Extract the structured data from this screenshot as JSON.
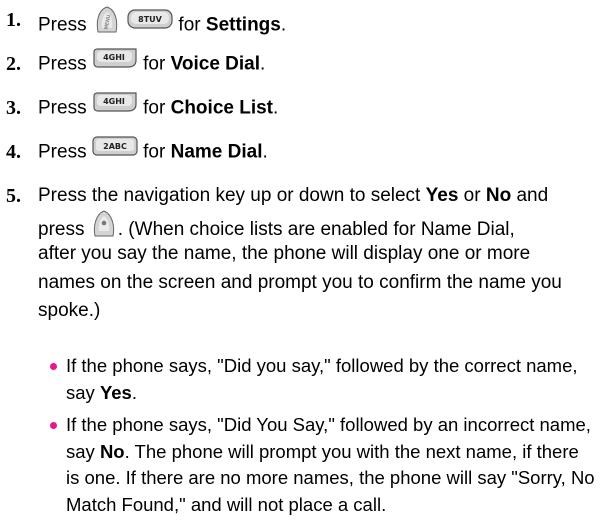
{
  "steps": [
    {
      "num": "1.",
      "pre": "Press",
      "mid": "for",
      "bold": "Settings",
      "post": ".",
      "keys": [
        "menu-key-icon",
        "8tuv-key-icon"
      ],
      "key_label_8": "8TUV"
    },
    {
      "num": "2.",
      "pre": "Press",
      "mid": "for",
      "bold": "Voice Dial",
      "post": ".",
      "keys": [
        "4ghi-key-icon"
      ],
      "key_label": "4GHI"
    },
    {
      "num": "3.",
      "pre": "Press",
      "mid": "for",
      "bold": "Choice List",
      "post": ".",
      "keys": [
        "4ghi-key-icon"
      ],
      "key_label": "4GHI"
    },
    {
      "num": "4.",
      "pre": "Press",
      "mid": "for",
      "bold": "Name Dial",
      "post": ".",
      "keys": [
        "2abc-key-icon"
      ],
      "key_label": "2ABC"
    }
  ],
  "step5": {
    "num": "5.",
    "line1_pre": "Press the navigation key up or down to select",
    "yes": "Yes",
    "or": "or",
    "no": "No",
    "and": "and",
    "line2_pre": "press",
    "line2_post": ". (When choice lists are enabled for Name Dial,",
    "rest": "after you say the name, the phone will display one or more names on the screen and prompt you to confirm the name you spoke.)"
  },
  "bullets": [
    {
      "pre": "If the phone says, \"Did you say,\" followed by the correct name, say",
      "bold": "Yes",
      "post": "."
    },
    {
      "pre": "If the phone says, \"Did You Say,\" followed by an incorrect name, say",
      "bold": "No",
      "post": ". The phone will prompt you with the next name, if there is one. If there are no more names, the phone will say \"Sorry, No Match Found,\" and will not place a call."
    }
  ],
  "colors": {
    "bullet": "#e9178a",
    "key_face": "#c9c9c9",
    "key_border": "#555555"
  }
}
